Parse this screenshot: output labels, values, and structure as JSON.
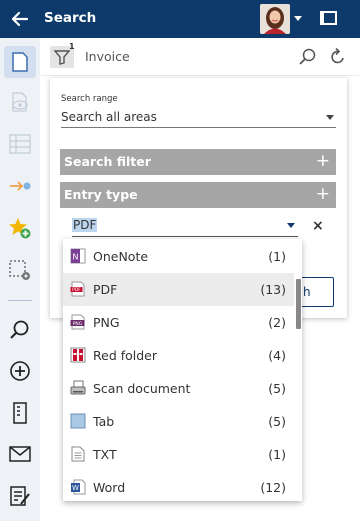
{
  "header": {
    "title": "Search"
  },
  "searchbar": {
    "filter_count": "1",
    "query": "Invoice"
  },
  "panel": {
    "range_label": "Search range",
    "range_value": "Search all areas",
    "search_filter_title": "Search filter",
    "entry_type_title": "Entry type",
    "entry_type_value": "PDF",
    "clear_symbol": "×",
    "button_partial": "h"
  },
  "dropdown": {
    "items": [
      {
        "label": "OneNote",
        "count": "(1)",
        "icon": "onenote-icon"
      },
      {
        "label": "PDF",
        "count": "(13)",
        "icon": "pdf-icon"
      },
      {
        "label": "PNG",
        "count": "(2)",
        "icon": "png-icon"
      },
      {
        "label": "Red folder",
        "count": "(4)",
        "icon": "red-folder-icon"
      },
      {
        "label": "Scan document",
        "count": "(5)",
        "icon": "scan-document-icon"
      },
      {
        "label": "Tab",
        "count": "(5)",
        "icon": "tab-icon"
      },
      {
        "label": "TXT",
        "count": "(1)",
        "icon": "txt-icon"
      },
      {
        "label": "Word",
        "count": "(12)",
        "icon": "word-icon"
      }
    ],
    "selected": "PDF"
  },
  "colors": {
    "header": "#0d3a6b",
    "section": "#a6a6a6",
    "selection": "#bcd5ef",
    "accent": "#0d3a6b"
  }
}
